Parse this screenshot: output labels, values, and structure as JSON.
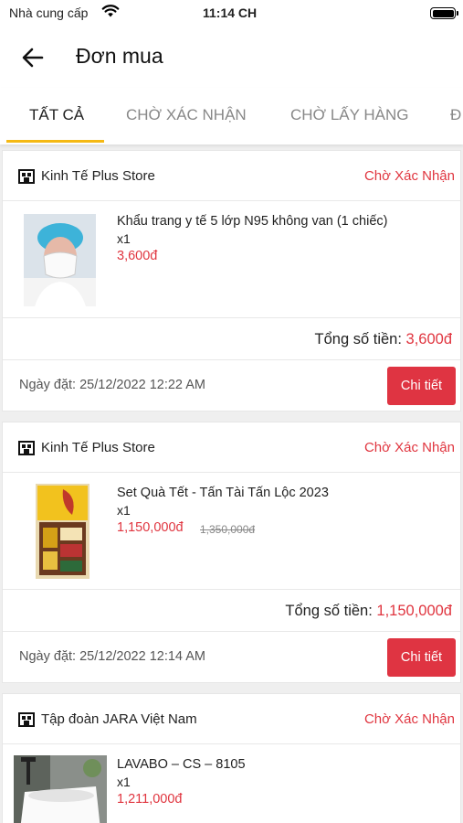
{
  "status_bar": {
    "carrier": "Nhà cung cấp",
    "time": "11:14 CH"
  },
  "header": {
    "title": "Đơn mua",
    "back_icon": "arrow-left-icon"
  },
  "tabs": [
    {
      "label": "TẤT CẢ",
      "active": true
    },
    {
      "label": "CHỜ XÁC NHẬN",
      "active": false
    },
    {
      "label": "CHỜ LẤY HÀNG",
      "active": false
    },
    {
      "label": "Đ",
      "active": false
    }
  ],
  "colors": {
    "accent": "#f5b914",
    "price": "#e0353f",
    "button": "#df3442"
  },
  "orders": [
    {
      "shop": "Kinh Tế Plus Store",
      "status": "Chờ Xác Nhận",
      "product": {
        "name": "Khẩu trang y tế 5 lớp N95 không van (1 chiếc)",
        "qty": "x1",
        "price": "3,600đ",
        "old_price": ""
      },
      "total_label": "Tổng số tiền:",
      "total": "3,600đ",
      "date": "Ngày đặt: 25/12/2022 12:22 AM",
      "button": "Chi tiết"
    },
    {
      "shop": "Kinh Tế Plus Store",
      "status": "Chờ Xác Nhận",
      "product": {
        "name": "Set Quà Tết - Tấn Tài Tấn Lộc 2023",
        "qty": "x1",
        "price": "1,150,000đ",
        "old_price": "1,350,000đ"
      },
      "total_label": "Tổng số tiền:",
      "total": "1,150,000đ",
      "date": "Ngày đặt: 25/12/2022 12:14 AM",
      "button": "Chi tiết"
    },
    {
      "shop": "Tập đoàn JARA Việt Nam",
      "status": "Chờ Xác Nhận",
      "product": {
        "name": "LAVABO – CS – 8105",
        "qty": "x1",
        "price": "1,211,000đ",
        "old_price": ""
      }
    }
  ]
}
